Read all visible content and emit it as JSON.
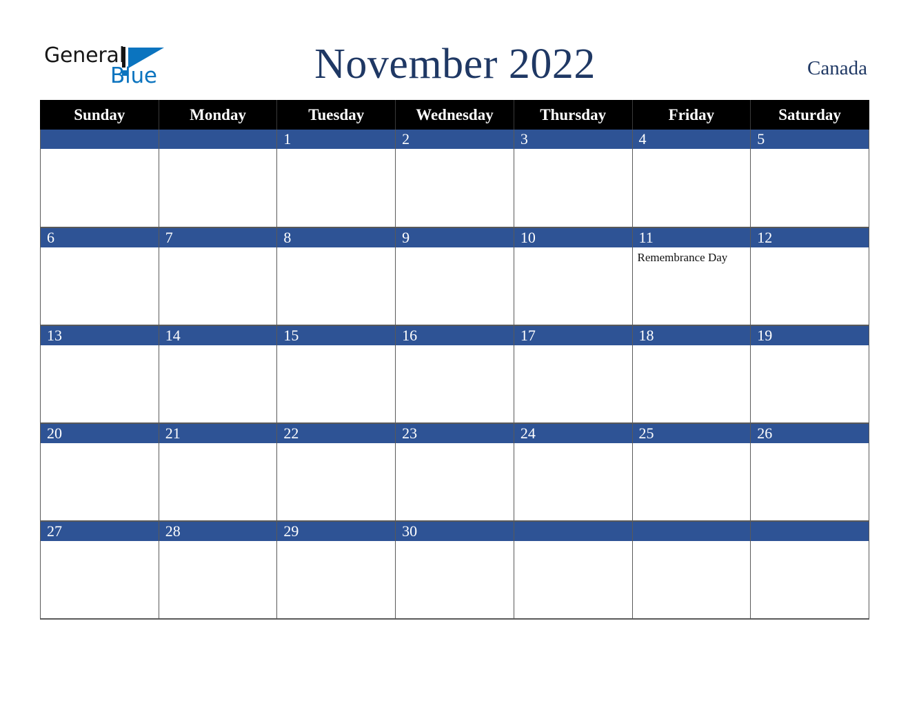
{
  "brand": {
    "name_part1": "General",
    "name_part2": "Blue",
    "accent_color": "#0b74bf"
  },
  "header": {
    "title": "November 2022",
    "region": "Canada",
    "title_color": "#1f3864"
  },
  "calendar": {
    "month": "November",
    "year": "2022",
    "weekday_headers": [
      "Sunday",
      "Monday",
      "Tuesday",
      "Wednesday",
      "Thursday",
      "Friday",
      "Saturday"
    ],
    "header_bg": "#000000",
    "date_bar_bg": "#2e5395",
    "grid_border": "#595959",
    "weeks": [
      [
        {
          "date": "",
          "events": []
        },
        {
          "date": "",
          "events": []
        },
        {
          "date": "1",
          "events": []
        },
        {
          "date": "2",
          "events": []
        },
        {
          "date": "3",
          "events": []
        },
        {
          "date": "4",
          "events": []
        },
        {
          "date": "5",
          "events": []
        }
      ],
      [
        {
          "date": "6",
          "events": []
        },
        {
          "date": "7",
          "events": []
        },
        {
          "date": "8",
          "events": []
        },
        {
          "date": "9",
          "events": []
        },
        {
          "date": "10",
          "events": []
        },
        {
          "date": "11",
          "events": [
            "Remembrance Day"
          ]
        },
        {
          "date": "12",
          "events": []
        }
      ],
      [
        {
          "date": "13",
          "events": []
        },
        {
          "date": "14",
          "events": []
        },
        {
          "date": "15",
          "events": []
        },
        {
          "date": "16",
          "events": []
        },
        {
          "date": "17",
          "events": []
        },
        {
          "date": "18",
          "events": []
        },
        {
          "date": "19",
          "events": []
        }
      ],
      [
        {
          "date": "20",
          "events": []
        },
        {
          "date": "21",
          "events": []
        },
        {
          "date": "22",
          "events": []
        },
        {
          "date": "23",
          "events": []
        },
        {
          "date": "24",
          "events": []
        },
        {
          "date": "25",
          "events": []
        },
        {
          "date": "26",
          "events": []
        }
      ],
      [
        {
          "date": "27",
          "events": []
        },
        {
          "date": "28",
          "events": []
        },
        {
          "date": "29",
          "events": []
        },
        {
          "date": "30",
          "events": []
        },
        {
          "date": "",
          "events": []
        },
        {
          "date": "",
          "events": []
        },
        {
          "date": "",
          "events": []
        }
      ]
    ]
  }
}
